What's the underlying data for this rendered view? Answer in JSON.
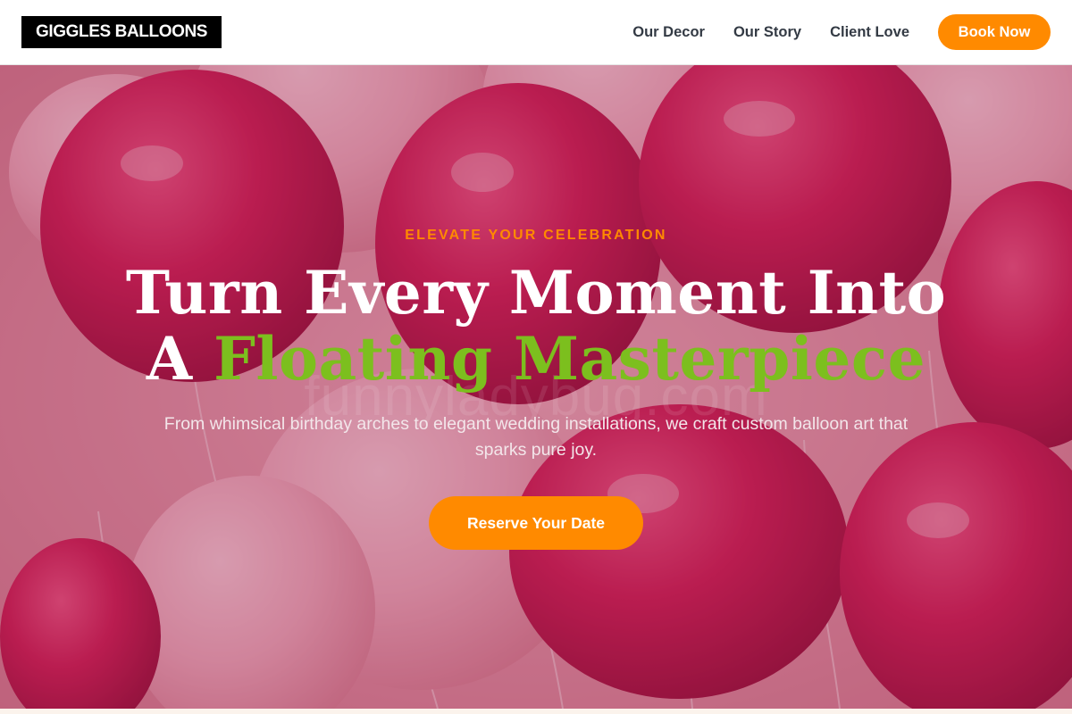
{
  "header": {
    "logo": "GIGGLES BALLOONS",
    "nav": [
      {
        "label": "Our Decor"
      },
      {
        "label": "Our Story"
      },
      {
        "label": "Client Love"
      }
    ],
    "cta_label": "Book Now"
  },
  "hero": {
    "eyebrow": "ELEVATE YOUR CELEBRATION",
    "headline_line1": "Turn Every Moment Into",
    "headline_line2_prefix": "A ",
    "headline_line2_accent": "Floating Masterpiece",
    "subtext": "From whimsical birthday arches to elegant wedding installations, we craft custom balloon art that sparks pure joy.",
    "cta_label": "Reserve Your Date",
    "watermark": "funnyladybug.com"
  },
  "colors": {
    "accent_orange": "#ff8a00",
    "accent_green": "#7cbf1e",
    "balloon_pink": "#c8194f",
    "logo_bg": "#000000"
  }
}
